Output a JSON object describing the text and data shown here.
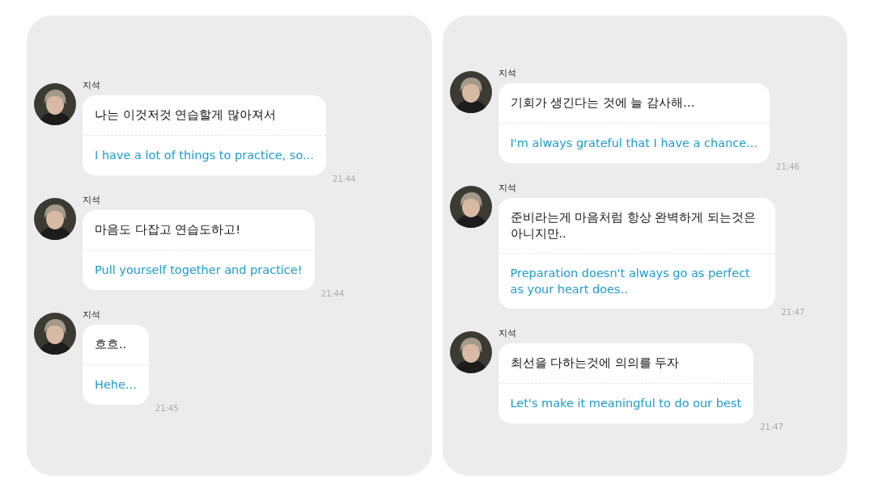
{
  "panels": [
    {
      "messages": [
        {
          "sender": "지석",
          "text": "나는 이것저것 연습할게 많아져서",
          "translation": "I have a lot of things to practice, so...",
          "time": "21:44"
        },
        {
          "sender": "지석",
          "text": "마음도 다잡고 연습도하고!",
          "translation": "Pull yourself together and practice!",
          "time": "21:44"
        },
        {
          "sender": "지석",
          "text": "흐흐..",
          "translation": "Hehe...",
          "time": "21:45"
        }
      ]
    },
    {
      "messages": [
        {
          "sender": "지석",
          "text": "기회가 생긴다는 것에 늘 감사해…",
          "translation": "I'm always grateful that I have a chance...",
          "time": "21:46"
        },
        {
          "sender": "지석",
          "text": "준비라는게 마음처럼 항상 완벽하게 되는것은 아니지만..",
          "translation": "Preparation doesn't always go as perfect as your heart does..",
          "time": "21:47"
        },
        {
          "sender": "지석",
          "text": "최선을 다하는것에 의의를 두자",
          "translation": "Let's make it meaningful to do our best",
          "time": "21:47"
        }
      ]
    }
  ]
}
